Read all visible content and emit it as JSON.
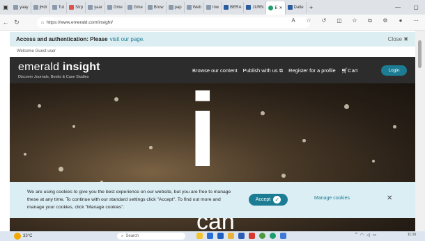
{
  "browser": {
    "tabs": [
      "yaay",
      "jHdr",
      "Tut",
      "Strp",
      "yaar",
      "Gme",
      "Gme",
      "Brow",
      "pap",
      "Web",
      "Inw",
      "BERA",
      "JURN",
      "E",
      "Dalte"
    ],
    "active_tab": "E",
    "url": "https://www.emerald.com/insight/"
  },
  "notice": {
    "text": "Access and authentication: Please",
    "link": "visit our page.",
    "close": "Close"
  },
  "welcome": "Welcome Guest user",
  "header": {
    "logo_light": "emerald",
    "logo_bold": "insight",
    "tagline": "Discover Journals, Books & Case Studies",
    "nav": [
      "Browse our content",
      "Publish with us",
      "Register for a profile",
      "Cart"
    ],
    "login": "Login"
  },
  "hero": {
    "big_letter": "i",
    "word": "can"
  },
  "cookie": {
    "text": "We are using cookies to give you the best experience on our website, but you are free to manage these at any time. To continue with our standard settings click \"Accept\". To find out more and manage your cookies, click \"Manage cookies\".",
    "accept": "Accept",
    "manage": "Manage cookies"
  },
  "taskbar": {
    "weather": "33°C",
    "search": "Search",
    "time": "11:16"
  },
  "colors": {
    "brand_teal": "#1c7c93",
    "header_bg": "#2c2c2c"
  }
}
